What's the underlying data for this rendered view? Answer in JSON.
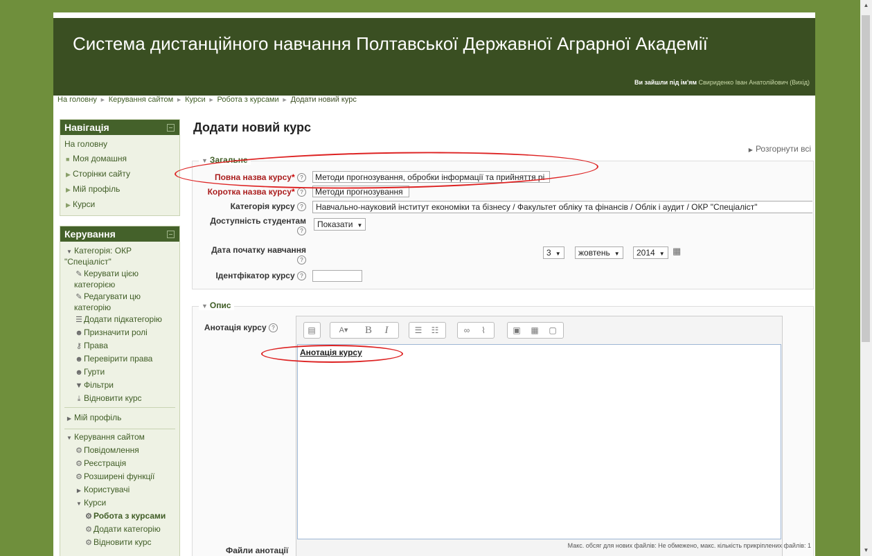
{
  "header": {
    "site_title": "Система дистанційного навчання Полтавської Державної Аграрної Академії",
    "login_prefix": "Ви зайшли під ім'ям",
    "user_name": "Свириденко Іван Анатолійович",
    "logout": "(Вихід)"
  },
  "breadcrumb": [
    "На головну",
    "Керування сайтом",
    "Курси",
    "Робота з курсами",
    "Додати новий курс"
  ],
  "navigation": {
    "title": "Навігація",
    "home": "На головну",
    "items": [
      "Моя домашня",
      "Сторінки сайту",
      "Мій профіль",
      "Курси"
    ]
  },
  "admin": {
    "title": "Керування",
    "category": "Категорія: ОКР \"Спеціаліст\"",
    "category_items": [
      "Керувати цією категорією",
      "Редагувати цю категорію",
      "Додати підкатегорію",
      "Призначити ролі",
      "Права",
      "Перевірити права",
      "Гурти",
      "Фільтри",
      "Відновити курс"
    ],
    "my_profile": "Мій профіль",
    "site_admin": "Керування сайтом",
    "site_items": [
      "Повідомлення",
      "Реєстрація",
      "Розширені функції",
      "Користувачі",
      "Курси"
    ],
    "course_items": [
      "Робота з курсами",
      "Додати категорію",
      "Відновити курс"
    ]
  },
  "page": {
    "title": "Додати новий курс",
    "expand_all": "Розгорнути всі"
  },
  "general": {
    "legend": "Загальне",
    "full_name_label": "Повна назва курсу",
    "full_name_value": "Методи прогнозування, обробки інформації та прийняття рі",
    "short_name_label": "Коротка назва курсу",
    "short_name_value": "Методи прогнозування",
    "category_label": "Категорія курсу",
    "category_value": "Навчально-науковий інститут економіки та бізнесу / Факультет обліку та фінансів / Облік і аудит / ОКР \"Спеціаліст\"",
    "visibility_label": "Доступність студентам",
    "visibility_value": "Показати",
    "start_date_label": "Дата початку навчання",
    "day": "3",
    "month": "жовтень",
    "year": "2014",
    "id_label": "Ідентфікатор курсу",
    "id_value": ""
  },
  "description": {
    "legend": "Опис",
    "summary_label": "Анотація курсу",
    "summary_text": "Анотація курсу",
    "files_label": "Файли анотації",
    "max_info": "Макс. обсяг для нових файлів: Не обмежено, макс. кількість прикріплених файлів: 1"
  },
  "colors": {
    "header_bg": "#3a4f22",
    "page_bg": "#6f8f3c",
    "block_head": "#44612a",
    "annotation": "#dd2222"
  }
}
